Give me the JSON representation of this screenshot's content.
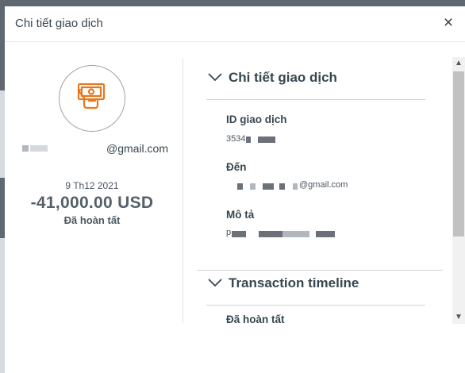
{
  "dialog": {
    "title": "Chi tiết giao dịch",
    "close_label": "×"
  },
  "summary": {
    "icon": "cash-payment-icon",
    "email_suffix": "@gmail.com",
    "date": "9 Th12 2021",
    "amount": "-41,000.00 USD",
    "status": "Đã hoàn tất"
  },
  "details_section": {
    "title": "Chi tiết giao dịch",
    "fields": [
      {
        "label": "ID giao dịch",
        "value": "3534"
      },
      {
        "label": "Đến",
        "value": "@gmail.com"
      },
      {
        "label": "Mô tả",
        "value": "p"
      }
    ]
  },
  "timeline_section": {
    "title": "Transaction timeline",
    "first_item": "Đã hoàn tất"
  },
  "colors": {
    "accent": "#e87722",
    "text": "#37474f",
    "backdrop": "#5f6771"
  }
}
